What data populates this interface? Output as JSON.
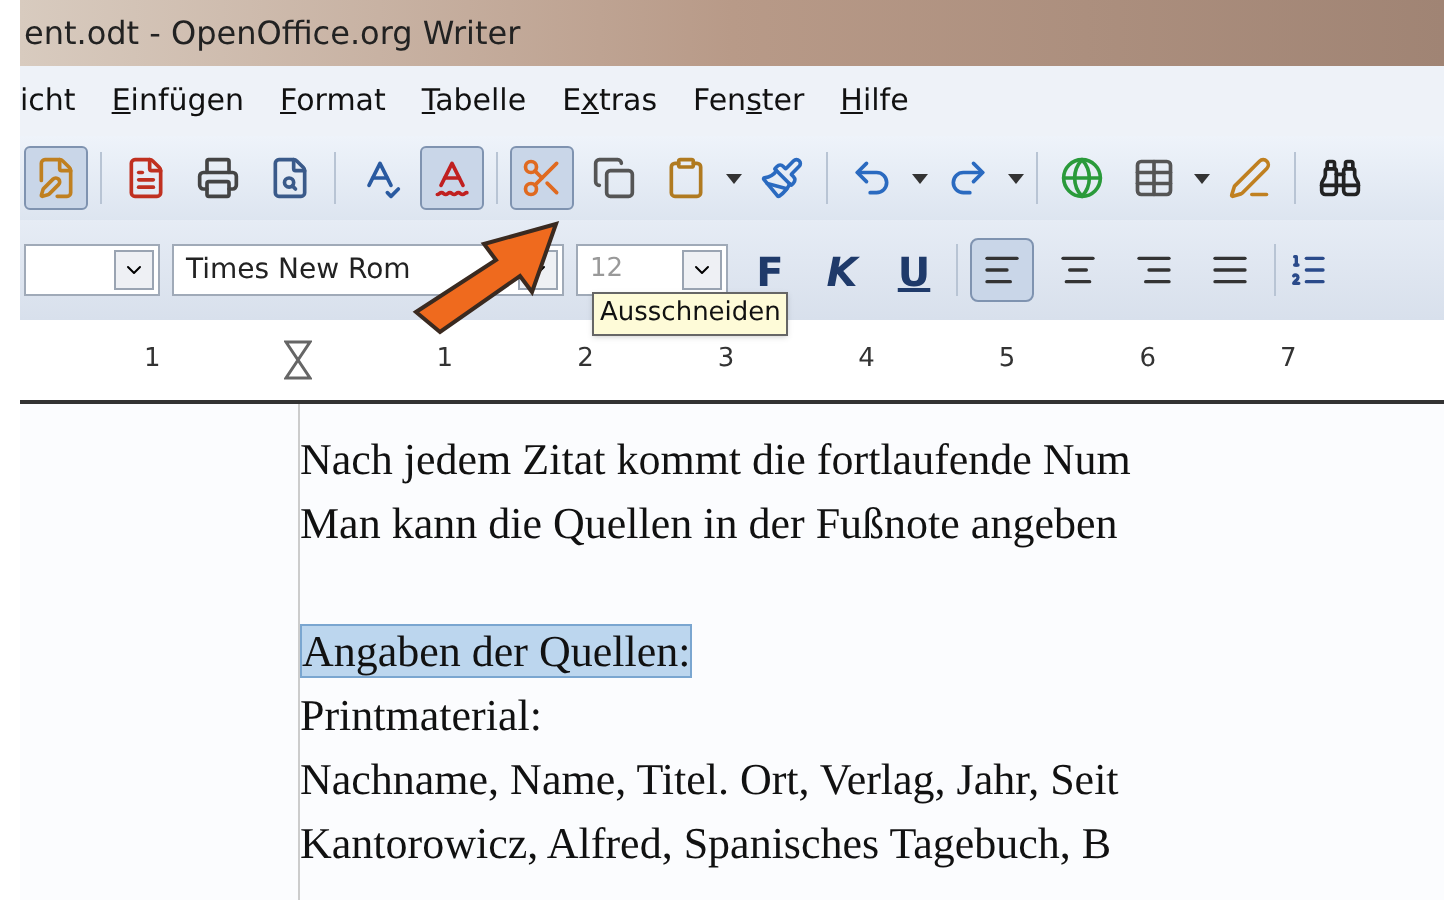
{
  "window": {
    "title": "ent.odt - OpenOffice.org Writer"
  },
  "menu": [
    {
      "pre": "icht"
    },
    {
      "key": "E",
      "post": "infügen"
    },
    {
      "key": "F",
      "post": "ormat"
    },
    {
      "key": "T",
      "post": "abelle"
    },
    {
      "pre": "E",
      "key": "x",
      "post": "tras"
    },
    {
      "pre": "Fen",
      "key": "s",
      "post": "ter"
    },
    {
      "key": "H",
      "post": "ilfe"
    }
  ],
  "toolbar": [
    [
      {
        "on": true
      }
    ],
    [
      {
        "on": false
      },
      {
        "on": false
      },
      {
        "on": false
      }
    ],
    [
      {
        "on": false
      },
      {
        "on": true
      }
    ],
    [
      {
        "on": true
      },
      {
        "on": false
      },
      {
        "on": false,
        "dropdown": true
      },
      {
        "on": false
      }
    ],
    [
      {
        "on": false,
        "dropdown": true
      },
      {
        "on": false,
        "dropdown": true
      }
    ],
    [
      {
        "on": false
      },
      {
        "on": false,
        "dropdown": true
      },
      {
        "on": false
      }
    ],
    [
      {
        "on": false
      }
    ]
  ],
  "format_bar": {
    "font": "Times New Rom",
    "size": "12",
    "styles": [
      {
        "label": "F",
        "on": false
      },
      {
        "label": "K",
        "on": false
      },
      {
        "label": "U",
        "on": false
      }
    ],
    "align": [
      {
        "on": true
      },
      {
        "on": false
      },
      {
        "on": false
      },
      {
        "on": false
      }
    ]
  },
  "tooltip": "Ausschneiden",
  "ruler": [
    "1",
    "1",
    "2",
    "3",
    "4",
    "5",
    "6",
    "7"
  ],
  "document": {
    "lines": [
      {
        "text": "Nach jedem Zitat kommt die fortlaufende Num",
        "selected": false
      },
      {
        "text": "Man kann die Quellen in der Fußnote angeben",
        "selected": false
      },
      {
        "text": "Angaben der Quellen:",
        "selected": true,
        "blank_line_before": true
      },
      {
        "text": "Printmaterial:",
        "selected": false
      },
      {
        "text": "Nachname, Name, Titel. Ort, Verlag, Jahr, Seit",
        "selected": false
      },
      {
        "text": "Kantorowicz, Alfred, Spanisches Tagebuch, B",
        "selected": false
      }
    ]
  }
}
